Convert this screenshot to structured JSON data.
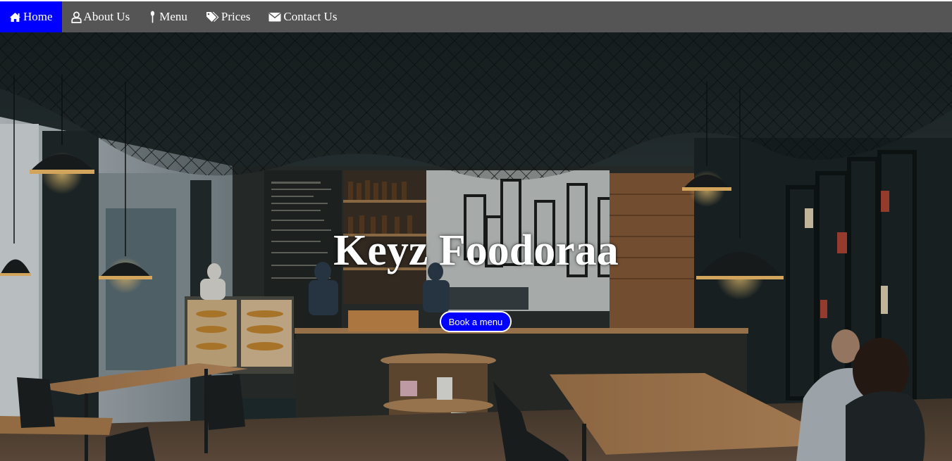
{
  "nav": {
    "items": [
      {
        "label": "Home",
        "icon": "home-icon",
        "active": true
      },
      {
        "label": "About Us",
        "icon": "user-icon",
        "active": false
      },
      {
        "label": "Menu",
        "icon": "spoon-icon",
        "active": false
      },
      {
        "label": "Prices",
        "icon": "tags-icon",
        "active": false
      },
      {
        "label": "Contact Us",
        "icon": "envelope-icon",
        "active": false
      }
    ]
  },
  "hero": {
    "title": "Keyz Foodoraa",
    "button_label": "Book a menu"
  },
  "colors": {
    "nav_background": "#555555",
    "nav_active": "#0000ff",
    "button_background": "#0000ff",
    "text": "#ffffff"
  }
}
